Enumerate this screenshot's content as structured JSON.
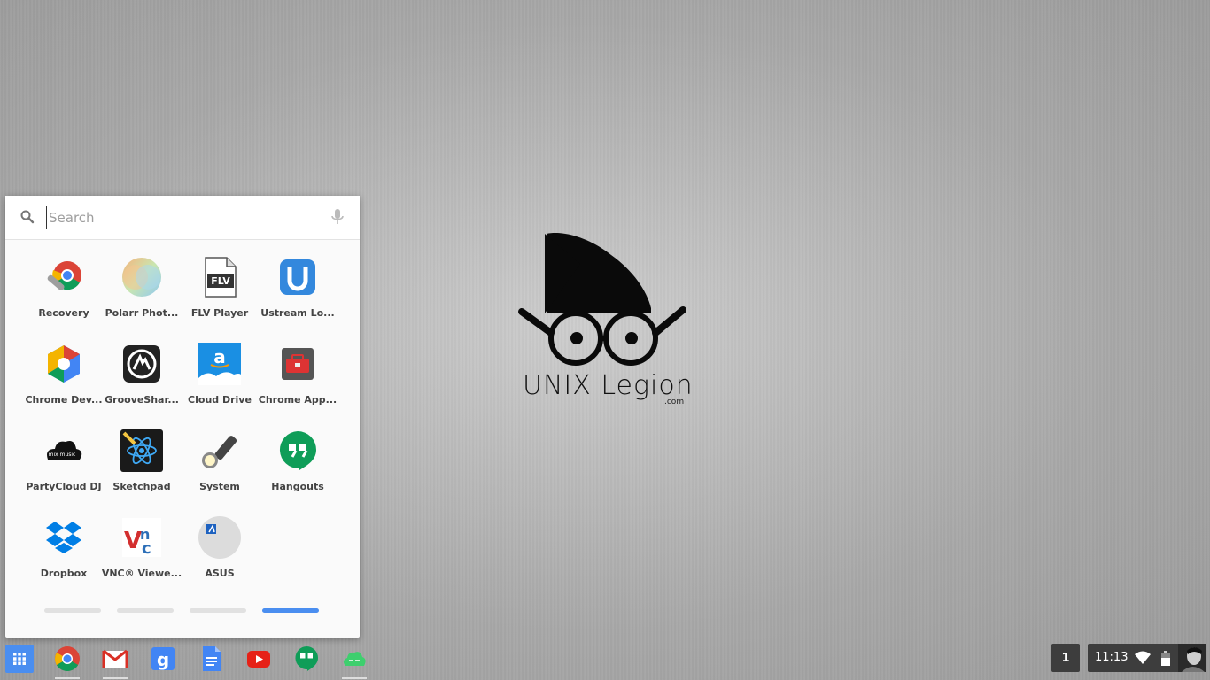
{
  "desktop": {
    "logo_text": "UNIX Legion",
    "logo_suffix": ".com"
  },
  "launcher": {
    "search": {
      "placeholder": "Search",
      "value": ""
    },
    "apps": [
      {
        "label": "Recovery",
        "icon": "recovery-icon"
      },
      {
        "label": "Polarr Phot...",
        "icon": "polarr-icon"
      },
      {
        "label": "FLV Player",
        "icon": "flv-player-icon"
      },
      {
        "label": "Ustream Lo...",
        "icon": "ustream-icon"
      },
      {
        "label": "Chrome Dev...",
        "icon": "chrome-dev-icon"
      },
      {
        "label": "GrooveShar...",
        "icon": "grooveshark-icon"
      },
      {
        "label": "Cloud Drive",
        "icon": "cloud-drive-icon"
      },
      {
        "label": "Chrome App...",
        "icon": "toolbox-icon"
      },
      {
        "label": "PartyCloud DJ",
        "icon": "partycloud-icon"
      },
      {
        "label": "Sketchpad",
        "icon": "sketchpad-icon"
      },
      {
        "label": "System",
        "icon": "flashlight-icon"
      },
      {
        "label": "Hangouts",
        "icon": "hangouts-icon"
      },
      {
        "label": "Dropbox",
        "icon": "dropbox-icon"
      },
      {
        "label": "VNC® Viewe...",
        "icon": "vnc-icon"
      },
      {
        "label": "ASUS",
        "icon": "asus-icon"
      }
    ],
    "pages": 4,
    "active_page": 4
  },
  "shelf": {
    "items": [
      "app-launcher-icon",
      "chrome-icon",
      "gmail-icon",
      "google-search-icon",
      "docs-icon",
      "youtube-icon",
      "hangouts-icon",
      "cloud-app-icon"
    ],
    "workspace_number": "1",
    "clock": "11:13"
  },
  "colors": {
    "accent": "#4a8ef0",
    "tray": "#3d3d3d"
  }
}
